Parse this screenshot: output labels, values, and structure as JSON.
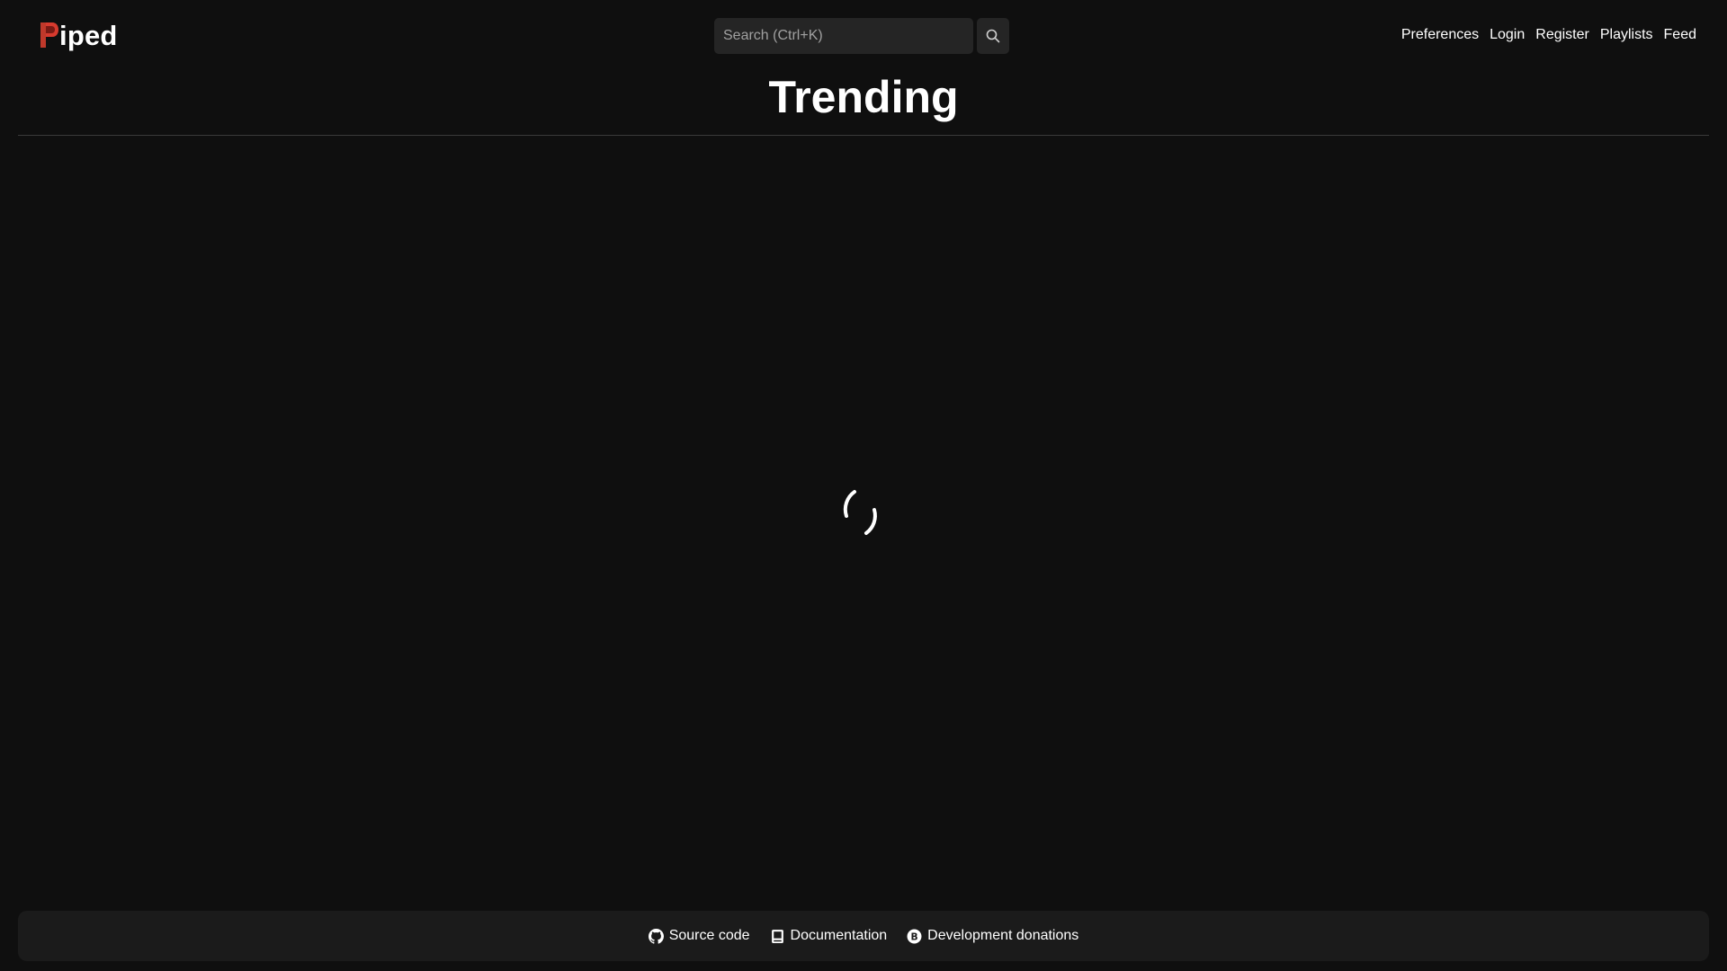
{
  "header": {
    "logo_text": "iped",
    "logo_letter": "P",
    "search": {
      "placeholder": "Search (Ctrl+K)",
      "value": ""
    },
    "nav": [
      {
        "label": "Preferences"
      },
      {
        "label": "Login"
      },
      {
        "label": "Register"
      },
      {
        "label": "Playlists"
      },
      {
        "label": "Feed"
      }
    ]
  },
  "main": {
    "title": "Trending",
    "state": "loading"
  },
  "footer": {
    "links": [
      {
        "label": "Source code",
        "icon": "github-icon"
      },
      {
        "label": "Documentation",
        "icon": "book-icon"
      },
      {
        "label": "Development donations",
        "icon": "bitcoin-icon"
      }
    ]
  },
  "colors": {
    "background": "#0f0f0f",
    "surface": "#252525",
    "footer": "#1b1b1b",
    "brand": "#d73a2e",
    "text": "#ffffff"
  }
}
